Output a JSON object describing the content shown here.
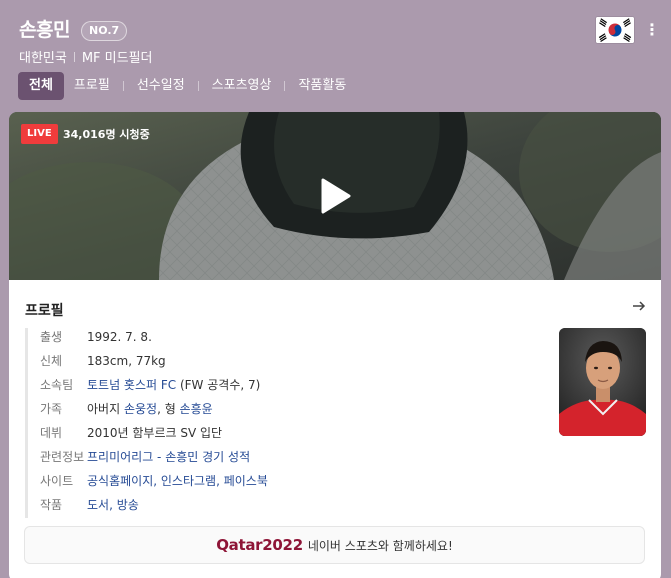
{
  "header": {
    "name": "손흥민",
    "number": "NO.7",
    "country": "대한민국",
    "position": "MF 미드필더",
    "more_icon": "more-vertical-icon"
  },
  "tabs": [
    {
      "label": "전체",
      "active": true
    },
    {
      "label": "프로필",
      "active": false
    },
    {
      "label": "선수일정",
      "active": false
    },
    {
      "label": "스포츠영상",
      "active": false
    },
    {
      "label": "작품활동",
      "active": false
    }
  ],
  "video": {
    "live_label": "LIVE",
    "viewers": "34,016명 시청중"
  },
  "profile": {
    "title": "프로필",
    "rows": [
      {
        "label": "출생",
        "value": "1992. 7. 8."
      },
      {
        "label": "신체",
        "value": "183cm, 77kg"
      },
      {
        "label": "소속팀",
        "link": "토트넘 홋스퍼 FC",
        "value": " (FW 공격수, 7)"
      },
      {
        "label": "가족",
        "value": "아버지 ",
        "link": "손웅정",
        "value2": ", 형 ",
        "link2": "손흥윤"
      },
      {
        "label": "데뷔",
        "value": "2010년 함부르크 SV 입단"
      },
      {
        "label": "관련정보",
        "link": "프리미어리그 - 손흥민 경기 성적"
      },
      {
        "label": "사이트",
        "link": "공식홈페이지, 인스타그램, 페이스북"
      },
      {
        "label": "작품",
        "link": "도서, 방송"
      }
    ]
  },
  "banner": {
    "logo": "Qatar2022",
    "message": "네이버 스포츠와 함께하세요!"
  },
  "colors": {
    "header_bg": "#ab9aad",
    "tab_active": "#6b5270",
    "link": "#264b95",
    "live": "#f03c3c",
    "brand": "#8e1537"
  }
}
